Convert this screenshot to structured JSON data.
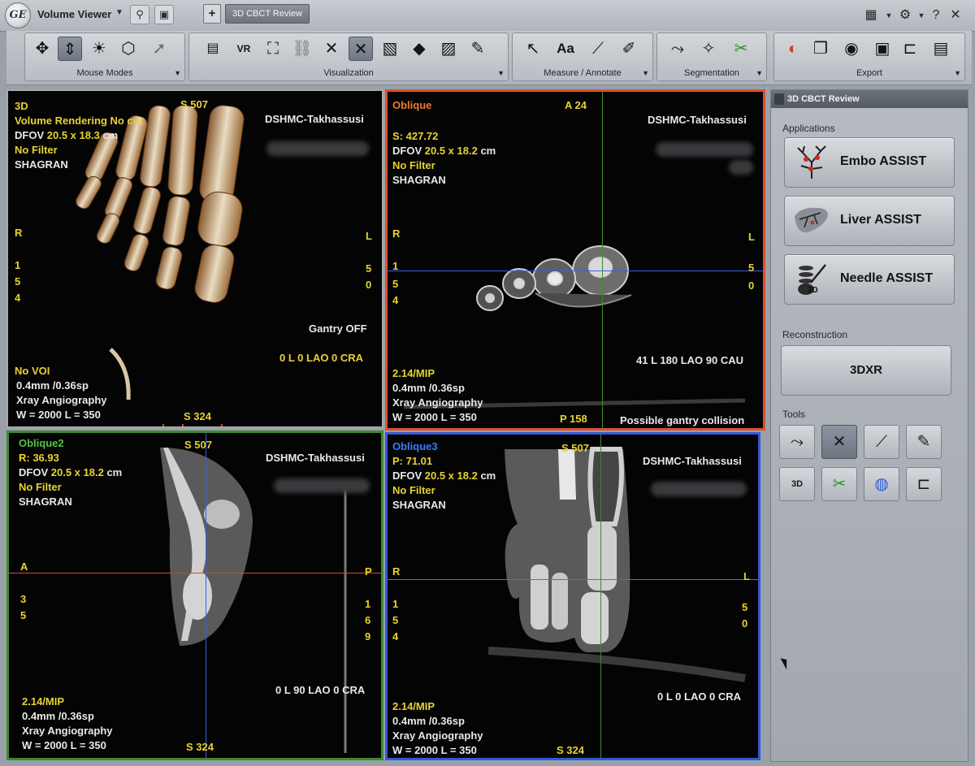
{
  "titlebar": {
    "app_name": "Volume Viewer",
    "active_tab": "3D CBCT Review",
    "add_tab": "+"
  },
  "toolbar": {
    "groups": [
      {
        "label": "Mouse Modes"
      },
      {
        "label": "Visualization"
      },
      {
        "label": "Measure / Annotate"
      },
      {
        "label": "Segmentation"
      },
      {
        "label": "Export"
      }
    ],
    "vr_button": "VR",
    "text_tool": "Aa"
  },
  "viewports": {
    "vr": {
      "title": "3D",
      "mode_line": "Volume Rendering No cut",
      "dfov_label": "DFOV",
      "dfov_value": "20.5 x 18.3",
      "dfov_unit": "cm",
      "filter": "No Filter",
      "site_code": "SHAGRAN",
      "institution": "DSHMC-Takhassusi",
      "top_orient": "S 507",
      "bottom_orient": "S 324",
      "left_orient": "R",
      "right_orient": "L",
      "left_digits": [
        "1",
        "5",
        "4"
      ],
      "right_digits": [
        "5",
        "0"
      ],
      "gantry": "Gantry OFF",
      "angle": "0 L 0 LAO 0 CRA",
      "voi": "No VOI",
      "slice": "0.4mm /0.36sp",
      "modality": "Xray Angiography",
      "window": "W = 2000 L = 350"
    },
    "oblique": {
      "title": "Oblique",
      "position": "S: 427.72",
      "dfov_label": "DFOV",
      "dfov_value": "20.5 x 18.2",
      "dfov_unit": "cm",
      "filter": "No Filter",
      "site_code": "SHAGRAN",
      "institution": "DSHMC-Takhassusi",
      "top_orient": "A 24",
      "bottom_orient": "P 158",
      "left_orient": "R",
      "right_orient": "L",
      "left_digits": [
        "1",
        "5",
        "4"
      ],
      "right_digits": [
        "5",
        "0"
      ],
      "angle": "41 L 180 LAO 90 CAU",
      "mip": "2.14/MIP",
      "slice": "0.4mm /0.36sp",
      "modality": "Xray Angiography",
      "window": "W = 2000 L = 350",
      "warning": "Possible gantry collision"
    },
    "oblique2": {
      "title": "Oblique2",
      "position": "R: 36.93",
      "dfov_label": "DFOV",
      "dfov_value": "20.5 x 18.2",
      "dfov_unit": "cm",
      "filter": "No Filter",
      "site_code": "SHAGRAN",
      "institution": "DSHMC-Takhassusi",
      "top_orient": "S 507",
      "bottom_orient": "S 324",
      "left_orient": "A",
      "right_orient": "P",
      "left_digits": [
        "3",
        "5"
      ],
      "right_digits": [
        "1",
        "6",
        "9"
      ],
      "angle": "0 L 90 LAO 0 CRA",
      "mip": "2.14/MIP",
      "slice": "0.4mm /0.36sp",
      "modality": "Xray Angiography",
      "window": "W = 2000 L = 350"
    },
    "oblique3": {
      "title": "Oblique3",
      "position": "P: 71.01",
      "dfov_label": "DFOV",
      "dfov_value": "20.5 x 18.2",
      "dfov_unit": "cm",
      "filter": "No Filter",
      "site_code": "SHAGRAN",
      "institution": "DSHMC-Takhassusi",
      "top_orient": "S 507",
      "bottom_orient": "S 324",
      "left_orient": "R",
      "right_orient": "L",
      "left_digits": [
        "1",
        "5",
        "4"
      ],
      "right_digits": [
        "5",
        "0"
      ],
      "angle": "0 L 0 LAO 0 CRA",
      "mip": "2.14/MIP",
      "slice": "0.4mm /0.36sp",
      "modality": "Xray Angiography",
      "window": "W = 2000 L = 350"
    }
  },
  "panel": {
    "title": "3D CBCT Review",
    "applications_label": "Applications",
    "apps": [
      {
        "label": "Embo ASSIST",
        "icon": "vessel-tree-icon"
      },
      {
        "label": "Liver ASSIST",
        "icon": "liver-icon"
      },
      {
        "label": "Needle ASSIST",
        "icon": "needle-3d-icon"
      }
    ],
    "reconstruction_label": "Reconstruction",
    "reconstruction_button": "3DXR",
    "tools_label": "Tools",
    "tool_3d_text": "3D"
  },
  "colors": {
    "oblique_border": "#e0502c",
    "oblique2_border": "#3f8a2f",
    "oblique3_border": "#2f5ad8",
    "overlay_yellow": "#e6d331"
  }
}
